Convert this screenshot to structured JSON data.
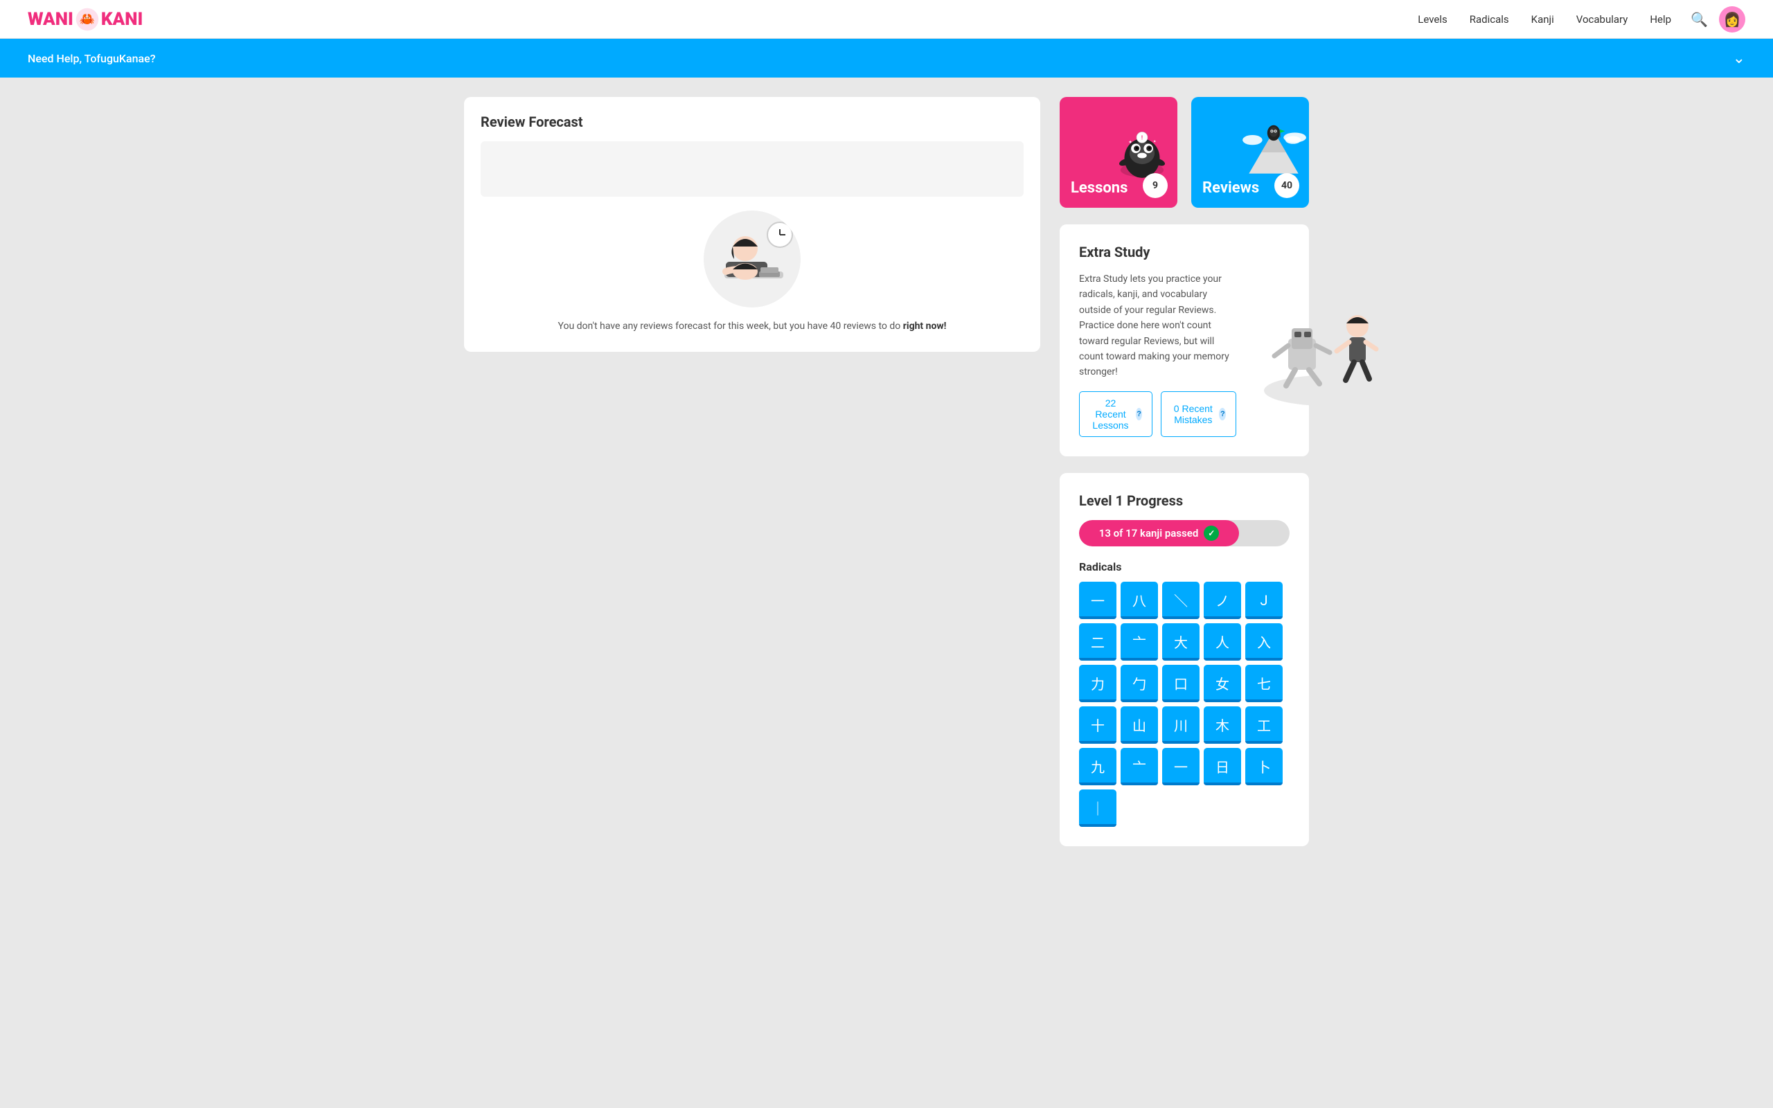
{
  "nav": {
    "logo": "WANI KANI",
    "links": [
      "Levels",
      "Radicals",
      "Kanji",
      "Vocabulary",
      "Help"
    ],
    "avatar_emoji": "👩"
  },
  "help_banner": {
    "text": "Need Help, TofuguKanae?",
    "chevron": "⌄"
  },
  "lessons_card": {
    "label": "Lessons",
    "badge": "9"
  },
  "reviews_card": {
    "label": "Reviews",
    "badge": "40"
  },
  "extra_study": {
    "title": "Extra Study",
    "description": "Extra Study lets you practice your radicals, kanji, and vocabulary outside of your regular Reviews. Practice done here won't count toward regular Reviews, but will count toward making your memory stronger!",
    "btn_lessons": "22 Recent Lessons",
    "btn_mistakes": "0 Recent Mistakes",
    "btn_help_label": "?"
  },
  "level_progress": {
    "title": "Level 1 Progress",
    "progress_text": "13 of 17 kanji passed",
    "progress_pct": 76,
    "checkmark": "✓"
  },
  "radicals": {
    "subtitle": "Radicals",
    "tiles": [
      "一",
      "八",
      "＼",
      "ノ",
      "J",
      "二",
      "亠",
      "大",
      "人",
      "入",
      "力",
      "勹",
      "口",
      "女",
      "七",
      "十",
      "山",
      "川",
      "木",
      "工",
      "九",
      "亠",
      "一",
      "日",
      "卜",
      "｜"
    ]
  },
  "review_forecast": {
    "title": "Review Forecast",
    "text_before": "You don't have any reviews forecast for this week, but you have 40 reviews to do",
    "text_bold": "right now!",
    "text_after": ""
  }
}
